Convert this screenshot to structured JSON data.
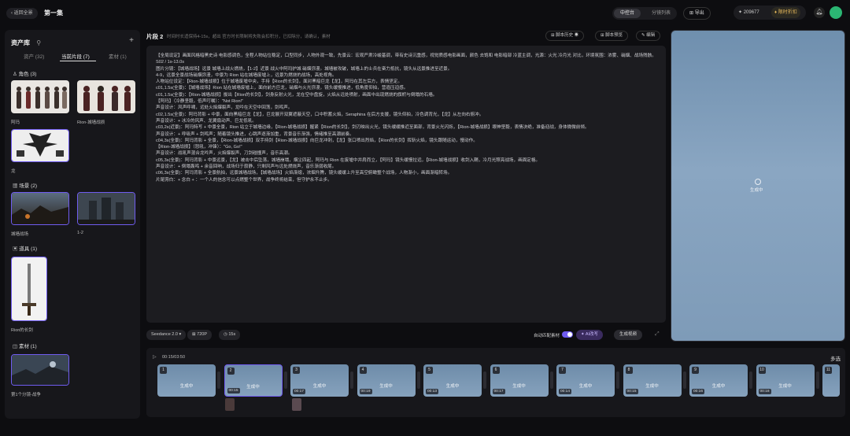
{
  "topbar": {
    "back_label": "‹ 返回全景",
    "project_title": "第一集",
    "mode_tabs": [
      "中控台",
      "分镜列表"
    ],
    "export_label": "⊞ 导出",
    "credits_value": "✦ 209677",
    "subscribe_label": "♦ 限时折扣"
  },
  "sidebar": {
    "title": "资产库",
    "tabs": [
      "资产 (32)",
      "当前片段 (7)",
      "素材 (1)"
    ],
    "sections": {
      "characters": "♙ 角色 (3)",
      "scenes": "▦ 场景 (2)",
      "props": "▣ 道具 (1)",
      "materials": "◫ 素材 (1)"
    },
    "character_captions": [
      "阿玛",
      "Rion-城墙战损",
      "龙"
    ],
    "scene_captions": [
      "城墙战场",
      "1-2"
    ],
    "prop_captions": [
      "Rion的长剑"
    ],
    "material_captions": [
      "第1个分镜-战争"
    ]
  },
  "main": {
    "segment_title": "片段 2",
    "segment_subtitle": "时间时长适保持4-15s，超出 官方时长限制将失败会扣积分，已扣除分，请确认，素材",
    "header_buttons": [
      "⊞ 脚本历史 ◉",
      "⊞ 脚本预览",
      "✎ 编辑"
    ],
    "script_lines": [
      "【全局设定】画面风格暗黑史诗 电影感调色，全程人物站位稳定，口型同步，人物外观一致，先景云：宏观严肃冷峻基调，带有史诗沉重感，视觉质感电影画面，颜色 去饱和 电影暗部 冷蓝主调，光源：火光 冷月光 对比，环境氛围：浓雾、硝烟、战场残骸。",
      "S02 / 1s-13.0s",
      "图片分镜：【城墙战场】远景 城墙上战火燃烧，【1-2】近景 战火中阿玛护城 硝烟弥漫。城墙被攻破，城墙上的士兵在奋力抵抗，镜头从远景推进至近景。",
      "4-9，远景全景战场硝烟弥漫，中景为 Rion 站在城墙废墟上，远景为燃烧的战场，高处视角。",
      "人物站位设定：【Rion-城墙战损】位于城墙废墟中央，手持【Rion的长剑】，面对黑暗巨龙【龙】，阿玛在其左后方，表情坚定。",
      "c01,1.5s(全景)：【城墙战场】Rion 站在城墙废墟上，面向前方巨龙，硝烟与火光弥漫，镜头缓慢推进，低角度仰拍，营造压迫感。",
      "c01,1.5s(全景)：【Rion-城墙战损】拔出【Rion的长剑】，剑身反射火光，龙在空中盘旋，火焰从远处喷射，画面中出现燃烧的旗帜与倒塌的石墙。",
      "【阿玛】（冷静坚毅，低声叮嘱）：\"Not Rion!\"",
      "声音设计：风声呼啸，远处火焰爆裂声，龙吟在天空中回荡，剑鸣声。",
      "c02,1.5s(全景)：阿玛背影 + 中景，面向黑暗巨龙【龙】，巨龙展开双翼遮蔽天空，口中积蓄火焰，Seraphina 在后方支援，镜头仰拍，冷色调背光，【龙】从左向右俯冲。",
      "声音设计：+ 冰冷的风声、龙翼扇动声、巨龙低吼。",
      "c03,2s(近景)：阿玛特写 + 中景全景，Rion 站立于城墙边缘，【Rion-城墙战损】握紧【Rion的长剑】，剑刃映出火光，镜头缓缓推近至面部，背景火光闪烁，【Rion-城墙战损】眼神坚毅，表情决绝，准备迎战，身体微微前倾。",
      "声音设计：+ 呼吸声 + 剑鸣声；随着镜头推进，心跳声逐渐加重，背景音乐渐强，情绪推至高潮前奏。",
      "c04,3s(全景)：阿玛背影 + 全景，【Rion-城墙战损】双手持剑【Rion-城墙战损】向巨龙冲刺，【龙】张口喷出烈焰，【Rion的长剑】挥斩火焰，镜头跟随运动，慢动作。",
      "【Rion-城墙战损】（怒吼，冲锋）：\"Go, Go!\"",
      "声音设计：战吼声混合龙吟声，火焰爆裂声，刀剑碰撞声，音乐高潮。",
      "c05,3s(全景)：阿玛背影 + 中景远景，【龙】被击中后坠落，城墙崩塌，烟尘四起，阿玛与 Rion 在废墟中并肩而立，【阿玛】镜头缓慢拉远，【Rion-城墙战损】收剑入鞘，冷月光照亮战场，画面定格。",
      "声音设计：+ 倒塌轰鸣 + 余音回响，战场归于寂静，只剩风声与远处燃烧声，音乐渐弱收尾。",
      "c06,3s(全景)：阿玛背影 + 全景航拍，远景城墙战场，【城墙战场】火焰渐熄，浓烟升腾，镜头缓缓上升至高空俯瞰整个战场，人物渐小，画面渐暗转场。",
      "片尾旁白：+ 念白 + ：一个人的信念可以点燃整个世界，战争终将结束，但守护永不止步。"
    ]
  },
  "settings": {
    "model": "Seedance 2.0 ▾",
    "resolution": "⊠ 720P",
    "duration": "◷ 15s",
    "auto_label": "自动匹配素材",
    "ai_label": "✦ AI改写",
    "generate_label": "生成视频"
  },
  "preview": {
    "status": "生成中"
  },
  "timeline": {
    "time_label": "00:15/03:50",
    "multi_label": "多选",
    "clips": [
      {
        "num": "1",
        "status": "生成中",
        "dur": ""
      },
      {
        "num": "2",
        "status": "生成中",
        "dur": "00:15"
      },
      {
        "num": "3",
        "status": "生成中",
        "dur": "00:17"
      },
      {
        "num": "4",
        "status": "生成中",
        "dur": "00:19"
      },
      {
        "num": "5",
        "status": "生成中",
        "dur": "00:13"
      },
      {
        "num": "6",
        "status": "生成中",
        "dur": "00:17"
      },
      {
        "num": "7",
        "status": "生成中",
        "dur": "00:14"
      },
      {
        "num": "8",
        "status": "生成中",
        "dur": "00:15"
      },
      {
        "num": "9",
        "status": "生成中",
        "dur": "00:16"
      },
      {
        "num": "10",
        "status": "生成中",
        "dur": "00:18"
      },
      {
        "num": "11",
        "status": "",
        "dur": ""
      }
    ]
  },
  "colors": {
    "accent": "#6f5cf0",
    "background": "#0d0d10",
    "panel": "#17171b",
    "gold": "#e6b85c"
  }
}
